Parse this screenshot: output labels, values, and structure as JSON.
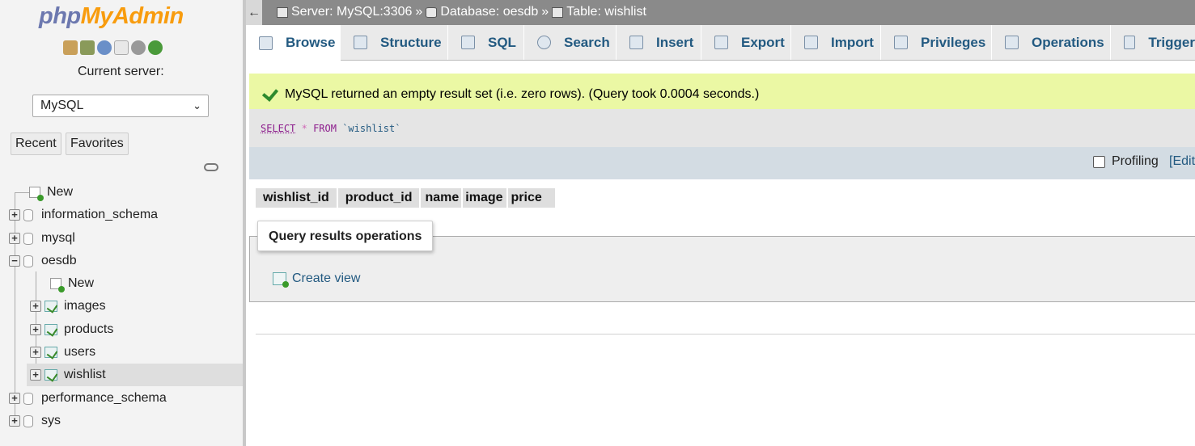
{
  "sidebar": {
    "logo_php": "php",
    "logo_myadmin": "MyAdmin",
    "quick_icons": [
      "home-icon",
      "logout-icon",
      "help-icon",
      "docs-icon",
      "settings-icon",
      "reload-icon"
    ],
    "current_server_label": "Current server:",
    "server_select_value": "MySQL",
    "recent_label": "Recent",
    "favorites_label": "Favorites",
    "tree": {
      "new": "New",
      "information_schema": "information_schema",
      "mysql": "mysql",
      "oesdb": "oesdb",
      "oesdb_new": "New",
      "images": "images",
      "products": "products",
      "users": "users",
      "wishlist": "wishlist",
      "performance_schema": "performance_schema",
      "sys": "sys"
    }
  },
  "topbar": {
    "back_arrow": "←",
    "server": "Server: MySQL:3306",
    "database": "Database: oesdb",
    "table": "Table: wishlist",
    "sep": "»"
  },
  "tabs": [
    {
      "label": "Browse",
      "icon": "browse-icon",
      "active": true
    },
    {
      "label": "Structure",
      "icon": "structure-icon"
    },
    {
      "label": "SQL",
      "icon": "sql-icon"
    },
    {
      "label": "Search",
      "icon": "search-icon"
    },
    {
      "label": "Insert",
      "icon": "insert-icon"
    },
    {
      "label": "Export",
      "icon": "export-icon"
    },
    {
      "label": "Import",
      "icon": "import-icon"
    },
    {
      "label": "Privileges",
      "icon": "privileges-icon"
    },
    {
      "label": "Operations",
      "icon": "operations-icon"
    },
    {
      "label": "Trigger",
      "icon": "triggers-icon"
    }
  ],
  "message": {
    "text": "MySQL returned an empty result set (i.e. zero rows). (Query took 0.0004 seconds.)"
  },
  "sql": {
    "select": "SELECT",
    "star": "*",
    "from": "FROM",
    "table": "`wishlist`"
  },
  "profiling": {
    "label": "Profiling",
    "edit": "[Edit"
  },
  "results": {
    "columns": [
      "wishlist_id",
      "product_id",
      "name",
      "image",
      "price"
    ]
  },
  "query_results_operations": {
    "legend": "Query results operations",
    "create_view": "Create view"
  },
  "colors": {
    "link": "#235a81",
    "success_bg": "#ebf8a4",
    "topbar_bg": "#8a8a8a",
    "logo_php": "#6c78af",
    "logo_myadmin": "#f89c0e"
  }
}
